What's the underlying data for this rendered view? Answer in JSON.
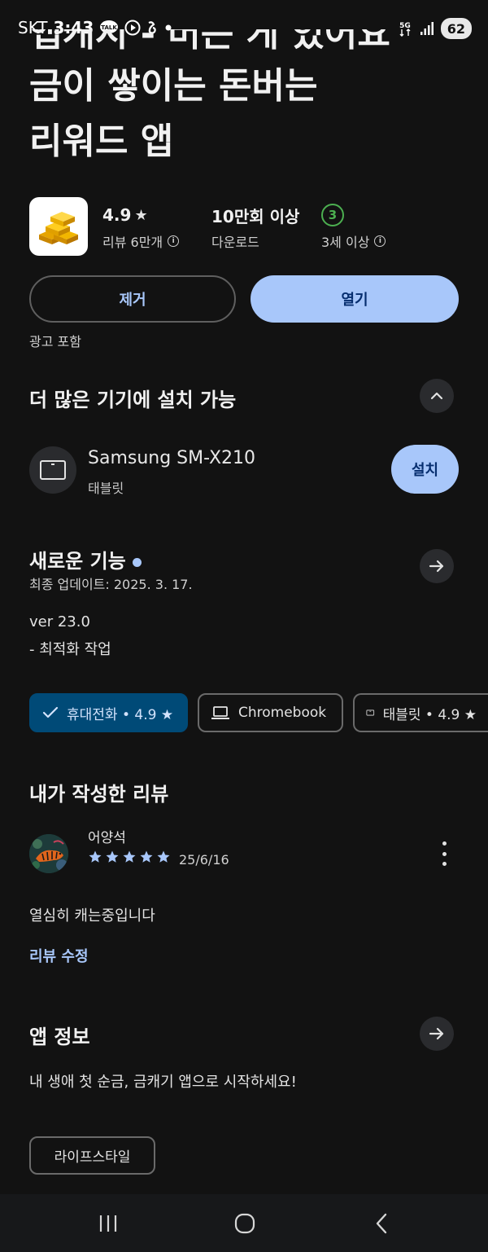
{
  "status_bar": {
    "carrier": "SKT",
    "time": "3:43",
    "talk_badge": "TALK",
    "network": "5G",
    "battery": "62"
  },
  "title_lines": [
    "앱캐시 - 버는 게 있어요",
    "금이 쌓이는 돈버는",
    "리워드 앱"
  ],
  "app_stats": {
    "rating": "4.9",
    "rating_star": "★",
    "reviews_label": "리뷰 6만개",
    "downloads_value": "10만회 이상",
    "downloads_label": "다운로드",
    "age_badge": "3",
    "age_label": "3세 이상"
  },
  "actions": {
    "uninstall": "제거",
    "open": "열기",
    "ads_note": "광고 포함"
  },
  "more_devices": {
    "heading": "더 많은 기기에 설치 가능",
    "device_name": "Samsung SM-X210",
    "device_type": "태블릿",
    "install": "설치"
  },
  "whats_new": {
    "heading": "새로운 기능",
    "updated": "최종 업데이트: 2025. 3. 17.",
    "version": "ver 23.0",
    "notes": "- 최적화 작업"
  },
  "device_chips": [
    {
      "label": "휴대전화 • 4.9 ★",
      "selected": true
    },
    {
      "label": "Chromebook",
      "selected": false
    },
    {
      "label": "태블릿 • 4.9 ★",
      "selected": false
    }
  ],
  "my_review": {
    "heading": "내가 작성한 리뷰",
    "reviewer": "어양석",
    "rating": 5,
    "date": "25/6/16",
    "text": "열심히 캐는중입니다",
    "edit": "리뷰 수정"
  },
  "app_info": {
    "heading": "앱 정보",
    "description": "내 생애 첫 순금, 금캐기 앱으로 시작하세요!",
    "category": "라이프스타일"
  },
  "colors": {
    "background": "#121212",
    "accent": "#a8c7fa",
    "selected_chip": "#004a77",
    "age_badge": "#4caf50"
  }
}
